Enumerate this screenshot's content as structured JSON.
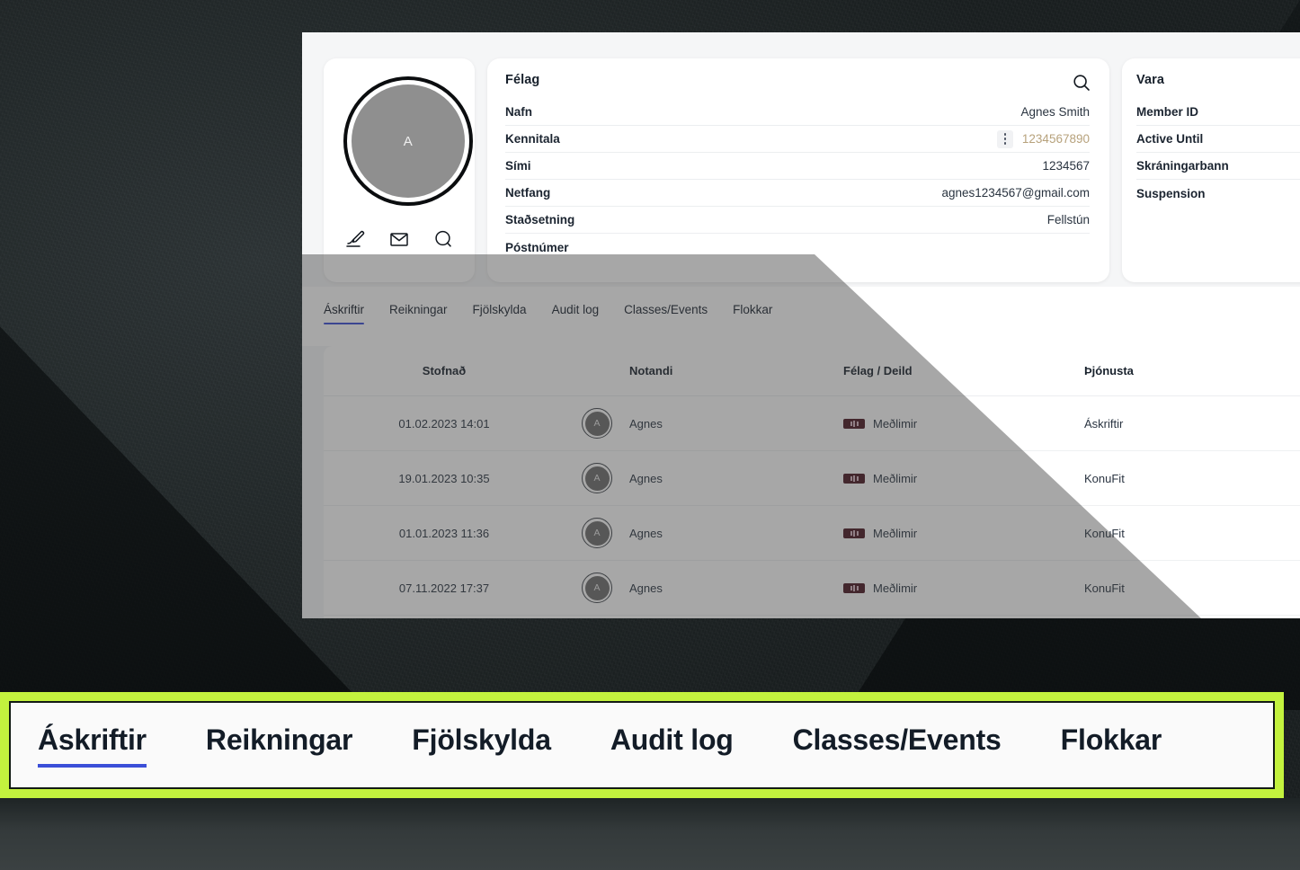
{
  "profile": {
    "avatar_initial": "A",
    "actions": [
      {
        "name": "signature-icon",
        "label": "Signature"
      },
      {
        "name": "mail-icon",
        "label": "Mail"
      },
      {
        "name": "chat-icon",
        "label": "Chat"
      }
    ]
  },
  "felag_card": {
    "title": "Félag",
    "search_icon": "search-icon",
    "rows": [
      {
        "key": "Nafn",
        "value": "Agnes Smith",
        "accent": false,
        "menu": false
      },
      {
        "key": "Kennitala",
        "value": "1234567890",
        "accent": true,
        "menu": true
      },
      {
        "key": "Sími",
        "value": "1234567",
        "accent": false,
        "menu": false
      },
      {
        "key": "Netfang",
        "value": "agnes1234567@gmail.com",
        "accent": false,
        "menu": false
      },
      {
        "key": "Staðsetning",
        "value": "Fellstún",
        "accent": false,
        "menu": false
      },
      {
        "key": "Póstnúmer",
        "value": "",
        "accent": false,
        "menu": false
      }
    ]
  },
  "vara_card": {
    "title": "Vara",
    "rows": [
      {
        "key": "Member ID",
        "value": ""
      },
      {
        "key": "Active Until",
        "value": ""
      },
      {
        "key": "Skráningarbann",
        "value": ""
      },
      {
        "key": "Suspension",
        "value": ""
      }
    ]
  },
  "tabs": [
    {
      "label": "Áskriftir",
      "active": true
    },
    {
      "label": "Reikningar",
      "active": false
    },
    {
      "label": "Fjölskylda",
      "active": false
    },
    {
      "label": "Audit log",
      "active": false
    },
    {
      "label": "Classes/Events",
      "active": false
    },
    {
      "label": "Flokkar",
      "active": false
    }
  ],
  "table": {
    "headers": {
      "stofnad": "Stofnað",
      "notandi": "Notandi",
      "felag_deild": "Félag / Deild",
      "thjonusta": "Þjónusta"
    },
    "rows": [
      {
        "stofnad": "01.02.2023 14:01",
        "avatar": "A",
        "notandi": "Agnes",
        "deild": "Meðlimir",
        "thjonusta": "Áskriftir"
      },
      {
        "stofnad": "19.01.2023 10:35",
        "avatar": "A",
        "notandi": "Agnes",
        "deild": "Meðlimir",
        "thjonusta": "KonuFit"
      },
      {
        "stofnad": "01.01.2023 11:36",
        "avatar": "A",
        "notandi": "Agnes",
        "deild": "Meðlimir",
        "thjonusta": "KonuFit"
      },
      {
        "stofnad": "07.11.2022 17:37",
        "avatar": "A",
        "notandi": "Agnes",
        "deild": "Meðlimir",
        "thjonusta": "KonuFit"
      }
    ]
  },
  "callout": {
    "border_color": "#c3f23e",
    "tabs": [
      {
        "label": "Áskriftir",
        "active": true
      },
      {
        "label": "Reikningar",
        "active": false
      },
      {
        "label": "Fjölskylda",
        "active": false
      },
      {
        "label": "Audit log",
        "active": false
      },
      {
        "label": "Classes/Events",
        "active": false
      },
      {
        "label": "Flokkar",
        "active": false
      }
    ]
  },
  "colors": {
    "accent_blue": "#3b4fd8",
    "kennitala_tan": "#b7a27c",
    "badge_maroon": "#4a1622",
    "highlight_green": "#c3f23e"
  }
}
